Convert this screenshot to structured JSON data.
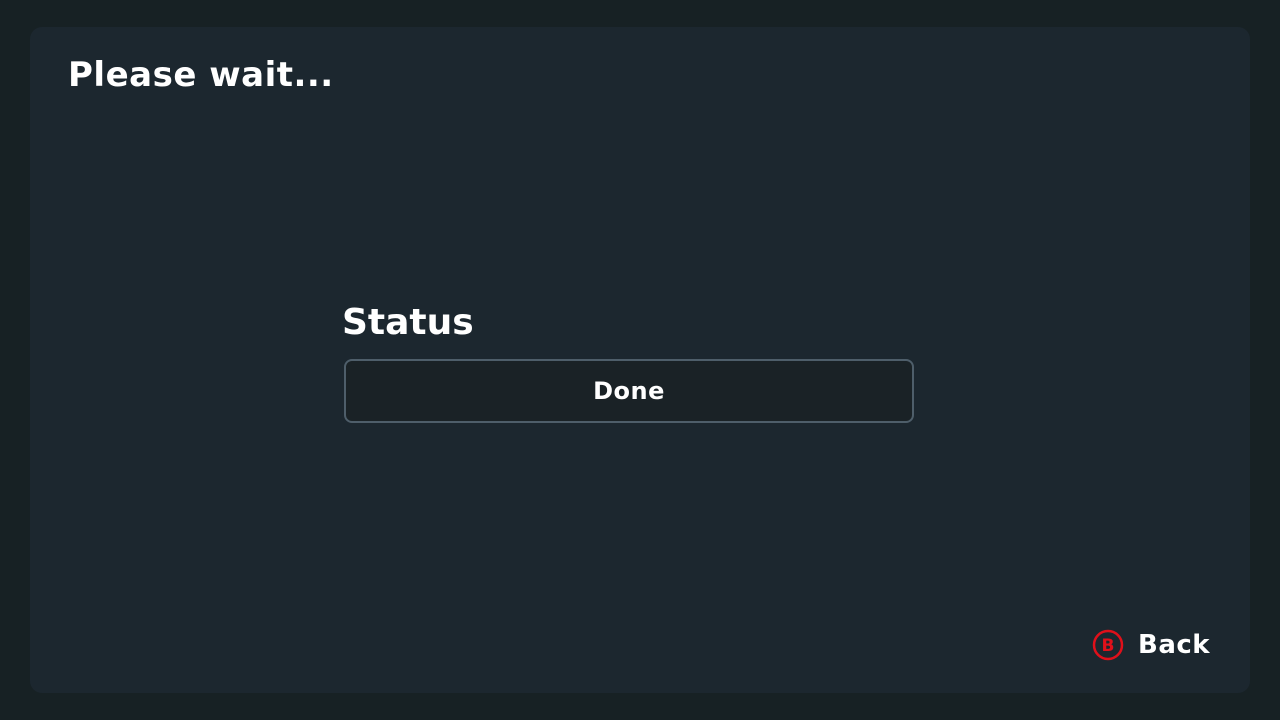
{
  "screen": {
    "title": "Please wait..."
  },
  "status": {
    "label": "Status",
    "value": "Done"
  },
  "footer": {
    "back_button": {
      "icon_letter": "B",
      "label": "Back",
      "icon": "b-button-icon",
      "icon_color": "#e0101a"
    }
  },
  "colors": {
    "background": "#172124",
    "panel": "#1c272f",
    "status_box": "#1a2226",
    "status_border": "#4e5e6a",
    "text": "#ffffff"
  }
}
